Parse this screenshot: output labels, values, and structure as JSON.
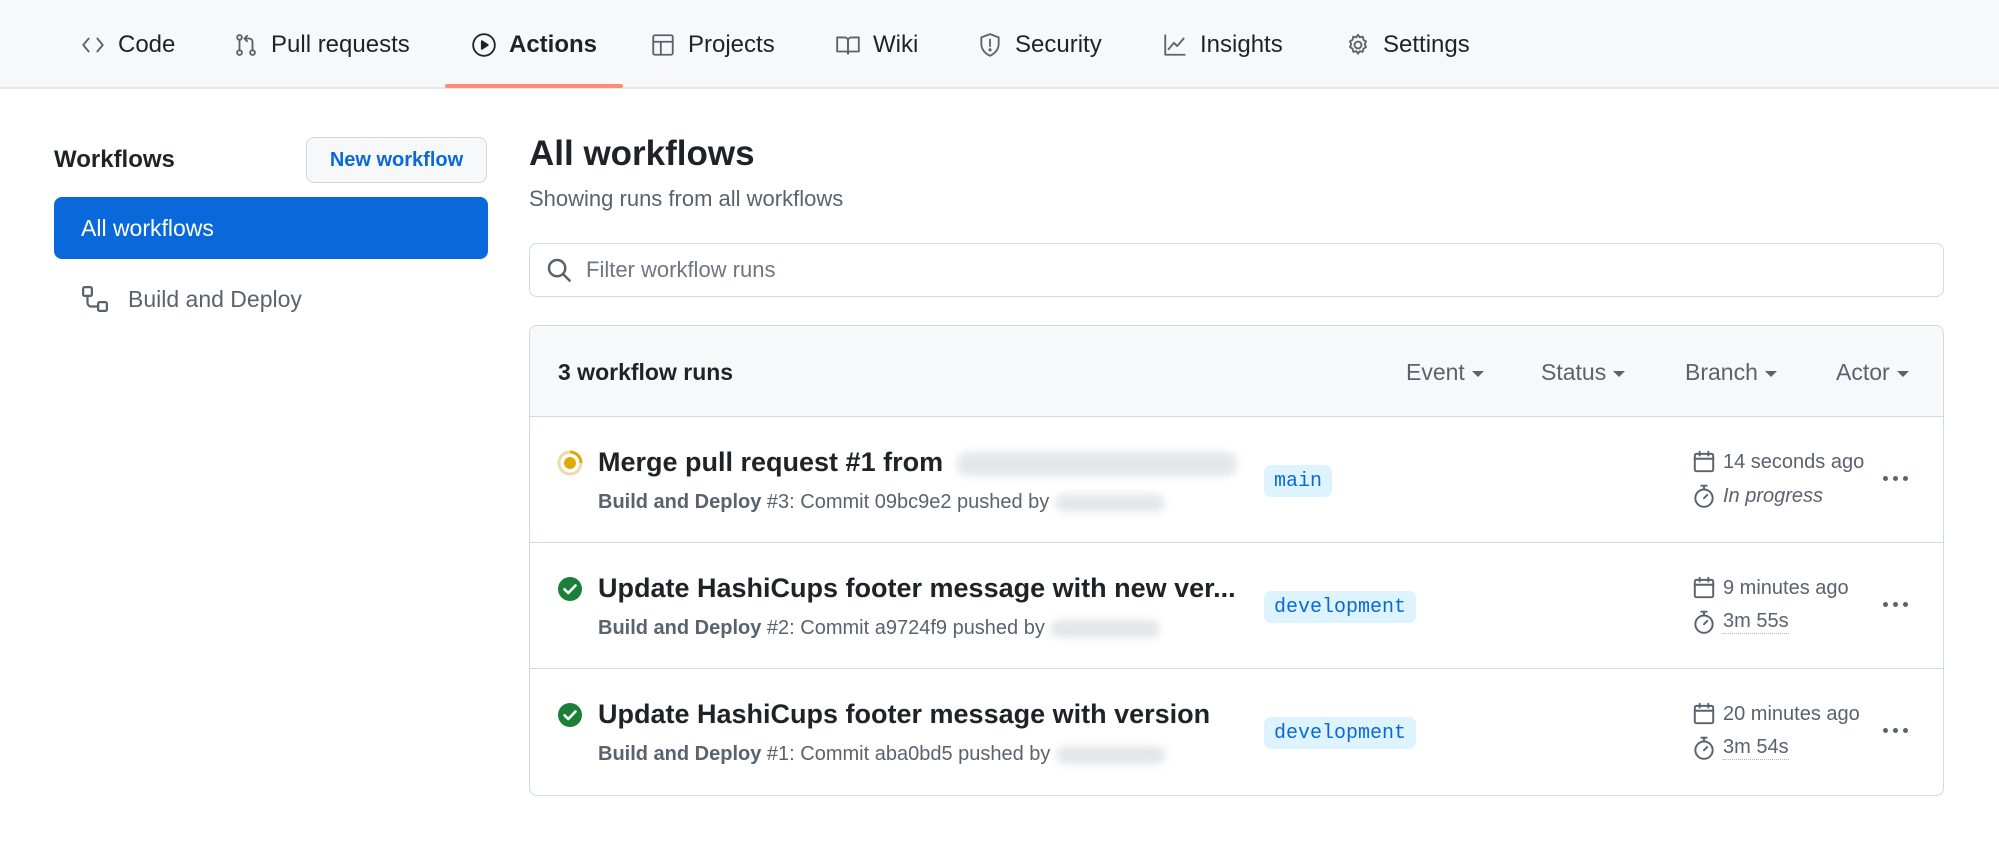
{
  "repo_nav": {
    "tabs": [
      {
        "label": "Code",
        "icon": "code-icon",
        "active": false
      },
      {
        "label": "Pull requests",
        "icon": "git-pull-request-icon",
        "active": false
      },
      {
        "label": "Actions",
        "icon": "play-icon",
        "active": true
      },
      {
        "label": "Projects",
        "icon": "table-icon",
        "active": false
      },
      {
        "label": "Wiki",
        "icon": "book-icon",
        "active": false
      },
      {
        "label": "Security",
        "icon": "shield-icon",
        "active": false
      },
      {
        "label": "Insights",
        "icon": "graph-icon",
        "active": false
      },
      {
        "label": "Settings",
        "icon": "gear-icon",
        "active": false
      }
    ],
    "active_underline_color": "#fd8c73"
  },
  "sidebar": {
    "title": "Workflows",
    "new_workflow_label": "New workflow",
    "items": [
      {
        "label": "All workflows",
        "selected": true
      },
      {
        "label": "Build and Deploy",
        "icon": "workflow-icon",
        "selected": false
      }
    ]
  },
  "main": {
    "title": "All workflows",
    "subtitle": "Showing runs from all workflows",
    "filter": {
      "placeholder": "Filter workflow runs",
      "value": ""
    },
    "runs_header": {
      "count_label": "3 workflow runs",
      "filters": [
        "Event",
        "Status",
        "Branch",
        "Actor"
      ]
    },
    "runs": [
      {
        "status": "in-progress",
        "title": "Merge pull request #1 from",
        "title_redacted": true,
        "workflow": "Build and Deploy",
        "run_number": "#3",
        "meta": ": Commit 09bc9e2 pushed by",
        "branch": "main",
        "when": "14 seconds ago",
        "duration": "In progress"
      },
      {
        "status": "success",
        "title": "Update HashiCups footer message with new ver...",
        "title_redacted": false,
        "workflow": "Build and Deploy",
        "run_number": "#2",
        "meta": ": Commit a9724f9 pushed by",
        "branch": "development",
        "when": "9 minutes ago",
        "duration": "3m 55s"
      },
      {
        "status": "success",
        "title": "Update HashiCups footer message with version",
        "title_redacted": false,
        "workflow": "Build and Deploy",
        "run_number": "#1",
        "meta": ": Commit aba0bd5 pushed by",
        "branch": "development",
        "when": "20 minutes ago",
        "duration": "3m 54s"
      }
    ]
  },
  "colors": {
    "accent": "#0969da",
    "success": "#1a7f37",
    "in_progress": "#dbab0a",
    "branch_bg": "#ddf4ff"
  }
}
